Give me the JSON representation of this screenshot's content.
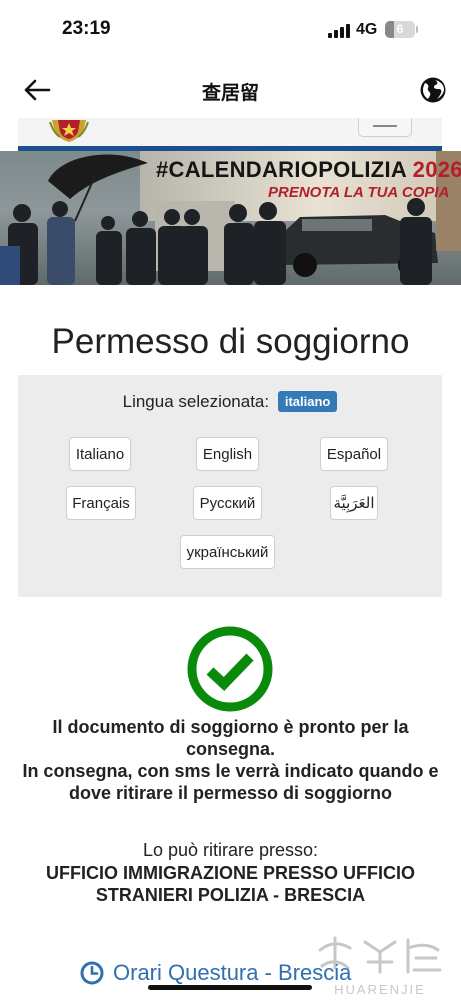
{
  "status_bar": {
    "time": "23:19",
    "network": "4G",
    "battery": "6",
    "battery_level_percent": 6
  },
  "nav": {
    "title": "查居留",
    "back_icon": "arrow-left-icon",
    "globe_icon": "globe-icon"
  },
  "banner": {
    "title_prefix": "#CALENDARIOPOLIZIA ",
    "title_year": "2026",
    "subtitle": "PRENOTA LA TUA COPIA"
  },
  "page": {
    "title": "Permesso di soggiorno"
  },
  "language": {
    "label": "Lingua selezionata:",
    "selected": "italiano",
    "options": [
      "Italiano",
      "English",
      "Español",
      "Français",
      "Русский",
      "العَرَبِيَّة",
      "український"
    ]
  },
  "status": {
    "line1": "Il documento di soggiorno è pronto per la consegna.",
    "line2": "In consegna, con sms le verrà indicato quando e dove ritirare il permesso di soggiorno",
    "icon": "check-circle-icon",
    "color": "#0a8a0a"
  },
  "pickup": {
    "label": "Lo può ritirare presso:",
    "office": "UFFICIO IMMIGRAZIONE PRESSO UFFICIO STRANIERI POLIZIA - BRESCIA"
  },
  "hours_link": {
    "label": "Orari Questura - Brescia",
    "icon": "clock-icon"
  },
  "watermark": {
    "text": "HUARENJIE"
  },
  "colors": {
    "accent": "#337ab7",
    "link": "#2f6fb2",
    "header_rule": "#1c4f8f",
    "success": "#0a8a0a"
  }
}
